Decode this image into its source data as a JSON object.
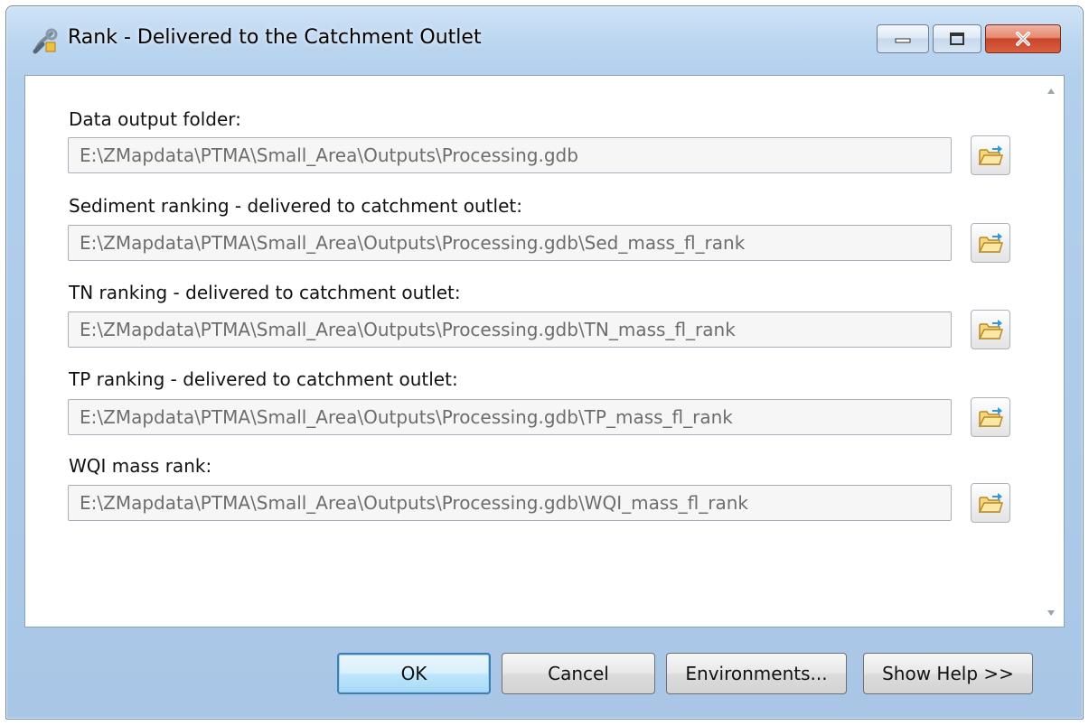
{
  "window": {
    "title": "Rank - Delivered to the Catchment Outlet",
    "icon": "geoprocessing-tool-icon"
  },
  "params": [
    {
      "label": "Data output folder:",
      "value": "E:\\ZMapdata\\PTMA\\Small_Area\\Outputs\\Processing.gdb"
    },
    {
      "label": "Sediment ranking - delivered to catchment outlet:",
      "value": "E:\\ZMapdata\\PTMA\\Small_Area\\Outputs\\Processing.gdb\\Sed_mass_fl_rank"
    },
    {
      "label": "TN ranking - delivered to catchment outlet:",
      "value": "E:\\ZMapdata\\PTMA\\Small_Area\\Outputs\\Processing.gdb\\TN_mass_fl_rank"
    },
    {
      "label": "TP ranking - delivered to catchment outlet:",
      "value": "E:\\ZMapdata\\PTMA\\Small_Area\\Outputs\\Processing.gdb\\TP_mass_fl_rank"
    },
    {
      "label": "WQI mass rank:",
      "value": "E:\\ZMapdata\\PTMA\\Small_Area\\Outputs\\Processing.gdb\\WQI_mass_fl_rank"
    }
  ],
  "buttons": {
    "ok": "OK",
    "cancel": "Cancel",
    "environments": "Environments...",
    "show_help": "Show Help >>"
  },
  "colors": {
    "frame": "#b2cfec",
    "close_button": "#c8452b",
    "default_button_border": "#3c7fb1"
  }
}
